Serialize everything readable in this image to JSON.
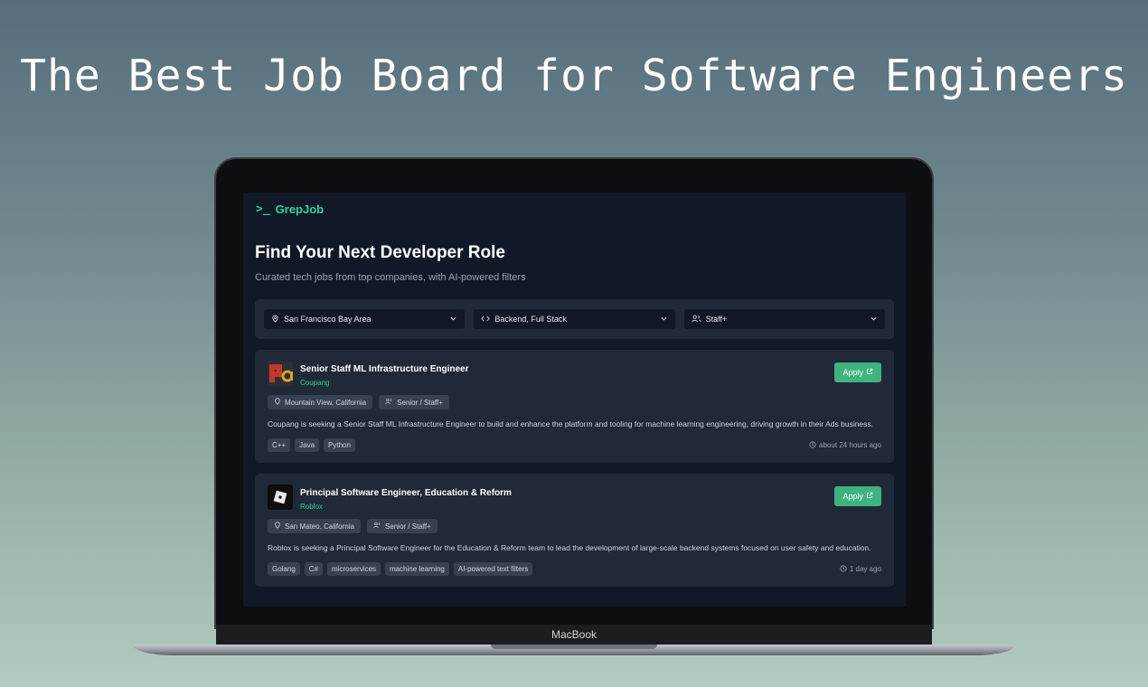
{
  "headline": "The Best Job Board for Software Engineers",
  "device_label": "MacBook",
  "app": {
    "logo_icon": ">_",
    "logo_text": "GrepJob",
    "hero_title": "Find Your Next Developer Role",
    "hero_subtitle": "Curated tech jobs from top companies, with AI-powered filters"
  },
  "filters": [
    {
      "icon": "map-pin-icon",
      "value": "San Francisco Bay Area"
    },
    {
      "icon": "code-icon",
      "value": "Backend, Full Stack"
    },
    {
      "icon": "users-icon",
      "value": "Staff+"
    }
  ],
  "jobs": [
    {
      "title": "Senior Staff ML Infrastructure Engineer",
      "company": "Coupang",
      "location": "Mountain View, California",
      "level": "Senior / Staff+",
      "description": "Coupang is seeking a Senior Staff ML Infrastructure Engineer to build and enhance the platform and tooling for machine learning engineering, driving growth in their Ads business.",
      "tags": [
        "C++",
        "Java",
        "Python"
      ],
      "posted": "about 24 hours ago",
      "apply_label": "Apply"
    },
    {
      "title": "Principal Software Engineer, Education & Reform",
      "company": "Roblox",
      "location": "San Mateo, California",
      "level": "Senior / Staff+",
      "description": "Roblox is seeking a Principal Software Engineer for the Education & Reform team to lead the development of large-scale backend systems focused on user safety and education.",
      "tags": [
        "Golang",
        "C#",
        "microservices",
        "machine learning",
        "AI-powered text filters"
      ],
      "posted": "1 day ago",
      "apply_label": "Apply"
    }
  ],
  "colors": {
    "accent": "#34d399",
    "apply_button": "#3fb37e",
    "screen_bg": "#111827",
    "card_bg": "#1f2937"
  }
}
